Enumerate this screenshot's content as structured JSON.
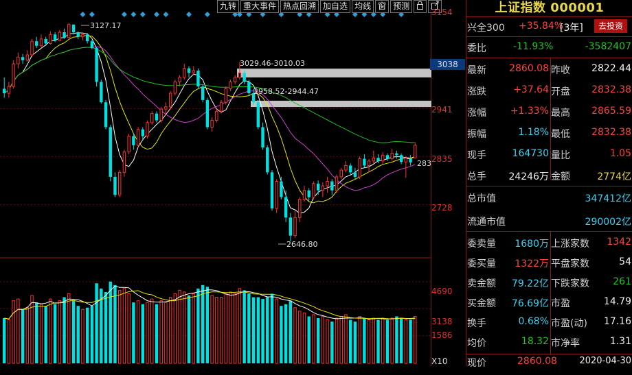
{
  "toolbar": [
    "九转",
    "重大事件",
    "热点回溯",
    "加自选",
    "均线",
    "窗",
    "预测"
  ],
  "axis": {
    "price_ticks": [
      "3154",
      "2941",
      "2835",
      "2728"
    ],
    "current_box": "3038",
    "right_partial": "283",
    "volume_ticks": [
      "4690",
      "3138",
      "1586"
    ],
    "volume_unit": "X10"
  },
  "annotations": {
    "high": "3127.17",
    "low": "2646.80",
    "gap1": "3029.46-3010.03",
    "gap2": "2958.52-2944.47"
  },
  "panel": {
    "title": "上证指数 000001",
    "industry_label": "兴全300",
    "industry_change": "+35.84%",
    "industry_period": "[3年]",
    "invest_button": "去投资",
    "weibi_label": "委比",
    "weibi_value": "-11.93%",
    "weicha_value": "-3582407",
    "latest_label": "最新",
    "latest_value": "2860.08",
    "prev_close_label": "昨收",
    "prev_close_value": "2822.44",
    "change_label": "涨跌",
    "change_value": "+37.64",
    "open_label": "开盘",
    "open_value": "2832.38",
    "pct_label": "涨幅",
    "pct_value": "+1.33%",
    "high_label": "最高",
    "high_value": "2865.59",
    "amp_label": "振幅",
    "amp_value": "1.18%",
    "low_label": "最低",
    "low_value": "2832.38",
    "cur_vol_label": "现手",
    "cur_vol_value": "164730",
    "vol_ratio_label": "量比",
    "vol_ratio_value": "1.05",
    "total_vol_label": "总手",
    "total_vol_value": "24246万",
    "amount_label": "金额",
    "amount_value": "2774亿",
    "mktcap_label": "总市值",
    "mktcap_value": "347412亿",
    "float_cap_label": "流通市值",
    "float_cap_value": "290002亿",
    "sell_vol_label": "委卖量",
    "sell_vol_value": "1680万",
    "up_count_label": "上涨家数",
    "up_count_value": "1342",
    "buy_vol_label": "委买量",
    "buy_vol_value": "1322万",
    "flat_count_label": "平盘家数",
    "flat_count_value": "54",
    "sell_amt_label": "卖金额",
    "sell_amt_value": "79.22亿",
    "down_count_label": "下跌家数",
    "down_count_value": "261",
    "buy_amt_label": "买金额",
    "buy_amt_value": "76.69亿",
    "pe_label": "市盈",
    "pe_value": "14.79",
    "turnover_label": "换手",
    "turnover_value": "0.68%",
    "pe_dyn_label": "市盈(动)",
    "pe_dyn_value": "17.16",
    "avg_label": "均价",
    "avg_value": "18.32",
    "pb_label": "市净率",
    "pb_value": "1.31",
    "bottom_label": "现价",
    "bottom_value": "2860.08",
    "bottom_date": "2020-04-30"
  },
  "colors": {
    "up": "#ff3232",
    "down": "#00e0e0",
    "ma5": "#ffffff",
    "ma10": "#e8e800",
    "ma20": "#d040d0",
    "ma60": "#20c020"
  },
  "chart_data": {
    "type": "candlestick",
    "price_range": [
      2620,
      3154
    ],
    "volume_range": [
      0,
      5200
    ],
    "candles": [
      [
        2985,
        2975,
        3010,
        2965,
        2600
      ],
      [
        2975,
        2990,
        3000,
        2965,
        2500
      ],
      [
        2990,
        3040,
        3048,
        2985,
        3600
      ],
      [
        3040,
        3055,
        3065,
        3030,
        3700
      ],
      [
        3055,
        3048,
        3062,
        3040,
        3100
      ],
      [
        3048,
        3060,
        3070,
        3045,
        3200
      ],
      [
        3060,
        3090,
        3095,
        3055,
        3900
      ],
      [
        3090,
        3080,
        3100,
        3075,
        3500
      ],
      [
        3080,
        3095,
        3105,
        3078,
        3400
      ],
      [
        3095,
        3085,
        3100,
        3080,
        3300
      ],
      [
        3085,
        3105,
        3112,
        3083,
        3700
      ],
      [
        3105,
        3092,
        3110,
        3088,
        3400
      ],
      [
        3092,
        3110,
        3115,
        3090,
        3600
      ],
      [
        3110,
        3098,
        3118,
        3095,
        3800
      ],
      [
        3098,
        3127,
        3130,
        3097,
        4000
      ],
      [
        3127,
        3110,
        3127,
        3105,
        3600
      ],
      [
        3110,
        3100,
        3112,
        3095,
        3300
      ],
      [
        3100,
        3105,
        3110,
        3092,
        3100
      ],
      [
        3105,
        3090,
        3108,
        3085,
        3200
      ],
      [
        3090,
        3075,
        3093,
        3072,
        3300
      ],
      [
        3075,
        3000,
        3078,
        2990,
        4600
      ],
      [
        3000,
        2955,
        3005,
        2952,
        4300
      ],
      [
        2955,
        2900,
        2960,
        2895,
        4100
      ],
      [
        2900,
        2790,
        2905,
        2780,
        4700
      ],
      [
        2790,
        2750,
        2800,
        2745,
        4500
      ],
      [
        2750,
        2800,
        2805,
        2745,
        4200
      ],
      [
        2800,
        2845,
        2850,
        2790,
        4300
      ],
      [
        2845,
        2880,
        2885,
        2840,
        4000
      ],
      [
        2880,
        2860,
        2885,
        2850,
        3500
      ],
      [
        2860,
        2895,
        2900,
        2855,
        3600
      ],
      [
        2895,
        2880,
        2900,
        2870,
        3400
      ],
      [
        2880,
        2910,
        2915,
        2875,
        3500
      ],
      [
        2910,
        2930,
        2935,
        2905,
        3700
      ],
      [
        2930,
        2915,
        2935,
        2910,
        3400
      ],
      [
        2915,
        2940,
        2945,
        2910,
        3600
      ],
      [
        2940,
        2945,
        2955,
        2930,
        3500
      ],
      [
        2945,
        2975,
        2980,
        2940,
        3800
      ],
      [
        2975,
        3000,
        3005,
        2970,
        4000
      ],
      [
        3000,
        3010,
        3015,
        2990,
        4200
      ],
      [
        3010,
        3030,
        3040,
        3005,
        4100
      ],
      [
        3030,
        3020,
        3035,
        3010,
        3900
      ],
      [
        3020,
        3025,
        3035,
        3015,
        4000
      ],
      [
        3025,
        2990,
        3030,
        2985,
        4300
      ],
      [
        2990,
        2960,
        2995,
        2955,
        4500
      ],
      [
        2960,
        2900,
        2965,
        2895,
        4400
      ],
      [
        2900,
        2915,
        2922,
        2890,
        3900
      ],
      [
        2915,
        2935,
        2940,
        2910,
        3800
      ],
      [
        2935,
        2955,
        2960,
        2930,
        3800
      ],
      [
        2955,
        2985,
        2990,
        2950,
        4000
      ],
      [
        2985,
        3000,
        3005,
        2980,
        4100
      ],
      [
        3000,
        3010,
        3015,
        2995,
        4000
      ],
      [
        3010,
        3020,
        3045,
        3005,
        4300
      ],
      [
        3020,
        3000,
        3025,
        2995,
        4200
      ],
      [
        3000,
        2975,
        3005,
        2970,
        4000
      ],
      [
        2975,
        2955,
        2985,
        2950,
        3800
      ],
      [
        2955,
        2900,
        2960,
        2895,
        3800
      ],
      [
        2900,
        2855,
        2910,
        2850,
        3700
      ],
      [
        2855,
        2800,
        2860,
        2795,
        3800
      ],
      [
        2800,
        2720,
        2805,
        2715,
        4000
      ],
      [
        2720,
        2780,
        2785,
        2710,
        3700
      ],
      [
        2780,
        2745,
        2790,
        2740,
        3300
      ],
      [
        2745,
        2700,
        2760,
        2690,
        3400
      ],
      [
        2700,
        2660,
        2710,
        2647,
        3600
      ],
      [
        2660,
        2700,
        2715,
        2655,
        3200
      ],
      [
        2700,
        2740,
        2745,
        2690,
        3000
      ],
      [
        2740,
        2760,
        2770,
        2735,
        2900
      ],
      [
        2760,
        2745,
        2765,
        2735,
        2700
      ],
      [
        2745,
        2775,
        2780,
        2740,
        2800
      ],
      [
        2775,
        2760,
        2782,
        2750,
        2600
      ],
      [
        2760,
        2770,
        2778,
        2745,
        2700
      ],
      [
        2770,
        2780,
        2790,
        2755,
        2500
      ],
      [
        2780,
        2760,
        2785,
        2750,
        2400
      ],
      [
        2760,
        2790,
        2795,
        2755,
        2600
      ],
      [
        2790,
        2805,
        2810,
        2785,
        2700
      ],
      [
        2805,
        2815,
        2825,
        2800,
        2800
      ],
      [
        2815,
        2800,
        2820,
        2795,
        2500
      ],
      [
        2800,
        2790,
        2810,
        2785,
        2400
      ],
      [
        2790,
        2830,
        2835,
        2785,
        2700
      ],
      [
        2830,
        2815,
        2840,
        2810,
        2600
      ],
      [
        2815,
        2825,
        2830,
        2800,
        2500
      ],
      [
        2825,
        2832,
        2848,
        2820,
        2600
      ],
      [
        2832,
        2825,
        2840,
        2820,
        2500
      ],
      [
        2825,
        2838,
        2845,
        2818,
        2600
      ],
      [
        2838,
        2830,
        2842,
        2825,
        2500
      ],
      [
        2830,
        2842,
        2852,
        2826,
        2600
      ],
      [
        2842,
        2838,
        2848,
        2830,
        2700
      ],
      [
        2838,
        2823,
        2842,
        2818,
        2600
      ],
      [
        2823,
        2831,
        2836,
        2788,
        2500
      ],
      [
        2831,
        2822,
        2838,
        2815,
        2500
      ],
      [
        2832,
        2860,
        2866,
        2832,
        2700
      ]
    ]
  }
}
